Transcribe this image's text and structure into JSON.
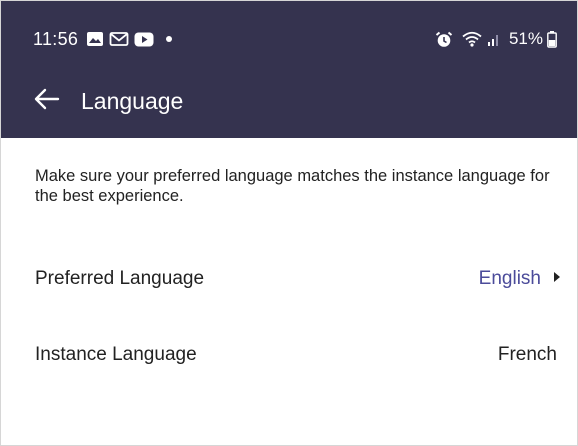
{
  "colors": {
    "header_bg": "#35334f",
    "accent": "#4b4b9a",
    "text": "#222222"
  },
  "status_bar": {
    "time": "11:56",
    "left_icons": [
      "image-notification-icon",
      "gmail-icon",
      "youtube-icon",
      "dot-icon"
    ],
    "right_icons": [
      "alarm-icon",
      "wifi-icon",
      "signal-icon",
      "battery-icon"
    ],
    "battery": "51%"
  },
  "header": {
    "back_icon": "arrow-left-icon",
    "title": "Language"
  },
  "main": {
    "intro": "Make sure your preferred language matches the instance language for the best experience.",
    "rows": [
      {
        "label": "Preferred Language",
        "value": "English",
        "icon": "caret-right-icon"
      },
      {
        "label": "Instance Language",
        "value": "French"
      }
    ]
  }
}
